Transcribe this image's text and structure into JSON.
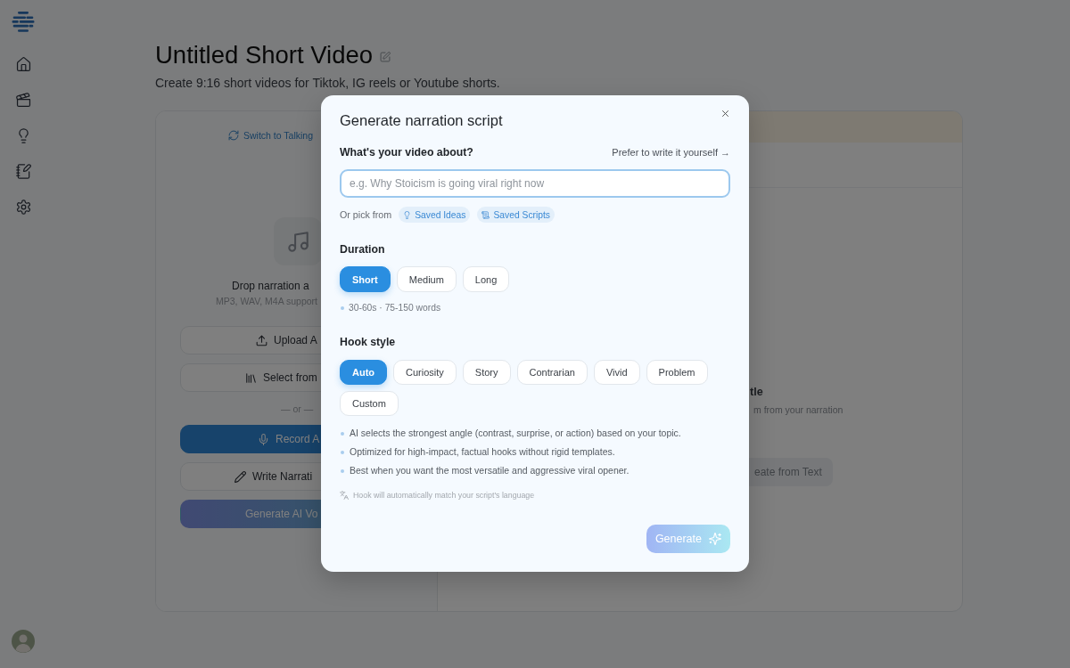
{
  "page": {
    "title": "Untitled Short Video",
    "subtitle": "Create 9:16 short videos for Tiktok, IG reels or Youtube shorts."
  },
  "left_panel": {
    "switch_link": "Switch to Talking",
    "drop_title": "Drop narration a",
    "drop_hint": "MP3, WAV, M4A support",
    "buttons": [
      {
        "label": "Upload A"
      },
      {
        "label": "Select from"
      }
    ],
    "divider": "— or —",
    "actions": [
      {
        "label": "Record A",
        "kind": "primary"
      },
      {
        "label": "Write Narrati",
        "kind": "outline"
      },
      {
        "label": "Generate AI Vo",
        "kind": "gradient"
      }
    ]
  },
  "right_panel": {
    "heading": "tle",
    "description": "m from your narration",
    "button": "eate from Text"
  },
  "modal": {
    "title": "Generate narration script",
    "topic": {
      "label": "What's your video about?",
      "link": "Prefer to write it yourself →",
      "placeholder": "e.g. Why Stoicism is going viral right now",
      "pick_label": "Or pick from",
      "chips": [
        "Saved Ideas",
        "Saved Scripts"
      ]
    },
    "duration": {
      "label": "Duration",
      "options": [
        {
          "label": "Short",
          "selected": true
        },
        {
          "label": "Medium",
          "selected": false
        },
        {
          "label": "Long",
          "selected": false
        }
      ],
      "hint": "30-60s · 75-150 words"
    },
    "hook_style": {
      "label": "Hook style",
      "options": [
        {
          "label": "Auto",
          "selected": true
        },
        {
          "label": "Curiosity",
          "selected": false
        },
        {
          "label": "Story",
          "selected": false
        },
        {
          "label": "Contrarian",
          "selected": false
        },
        {
          "label": "Vivid",
          "selected": false
        },
        {
          "label": "Problem",
          "selected": false
        },
        {
          "label": "Custom",
          "selected": false
        }
      ],
      "notes": [
        "AI selects the strongest angle (contrast, surprise, or action) based on your topic.",
        "Optimized for high-impact, factual hooks without rigid templates.",
        "Best when you want the most versatile and aggressive viral opener."
      ],
      "language_note": "Hook will automatically match your script's language"
    },
    "generate_button": {
      "label": "Generate",
      "disabled": true
    }
  }
}
